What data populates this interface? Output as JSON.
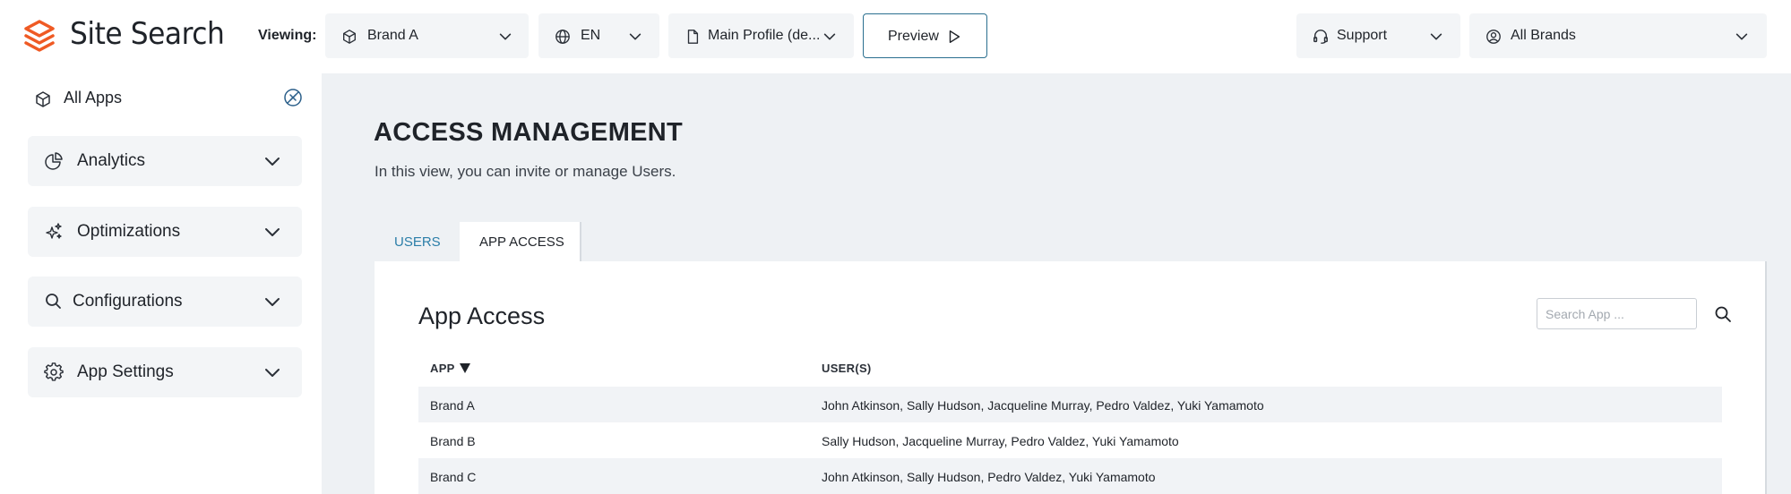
{
  "header": {
    "app_title": "Site Search",
    "viewing_label": "Viewing:",
    "brand_select": {
      "value": "Brand A",
      "icon": "cube-icon"
    },
    "language_select": {
      "value": "EN",
      "icon": "globe-icon"
    },
    "profile_select": {
      "value": "Main Profile (de...",
      "icon": "document-icon"
    },
    "preview_button": {
      "label": "Preview",
      "icon": "play-icon"
    },
    "support_select": {
      "value": "Support",
      "icon": "headset-icon"
    },
    "brands_select": {
      "value": "All Brands",
      "icon": "user-circle-icon"
    },
    "accent_color": "#ef5a24"
  },
  "sidebar": {
    "all_apps_label": "All Apps",
    "items": [
      {
        "label": "Analytics",
        "icon": "pie-chart-icon"
      },
      {
        "label": "Optimizations",
        "icon": "sparkle-icon"
      },
      {
        "label": "Configurations",
        "icon": "search-icon"
      },
      {
        "label": "App Settings",
        "icon": "gear-icon"
      }
    ]
  },
  "main": {
    "title": "ACCESS MANAGEMENT",
    "subtitle": "In this view, you can invite or manage Users.",
    "tabs": [
      {
        "label": "USERS",
        "active": false
      },
      {
        "label": "APP ACCESS",
        "active": true
      }
    ],
    "card": {
      "title": "App Access",
      "search_placeholder": "Search App ...",
      "columns": [
        "APP",
        "USER(S)"
      ],
      "sort_indicator": "descending",
      "rows": [
        {
          "app": "Brand A",
          "users": "John Atkinson, Sally Hudson, Jacqueline Murray, Pedro Valdez, Yuki Yamamoto"
        },
        {
          "app": "Brand B",
          "users": "Sally Hudson, Jacqueline Murray, Pedro Valdez, Yuki Yamamoto"
        },
        {
          "app": "Brand C",
          "users": "John Atkinson, Sally Hudson, Pedro Valdez, Yuki Yamamoto"
        }
      ]
    }
  },
  "colors": {
    "link": "#2b7ea8",
    "preview_border": "#2a6f8f",
    "main_background": "#eef1f4",
    "control_background": "#f3f5f7"
  }
}
